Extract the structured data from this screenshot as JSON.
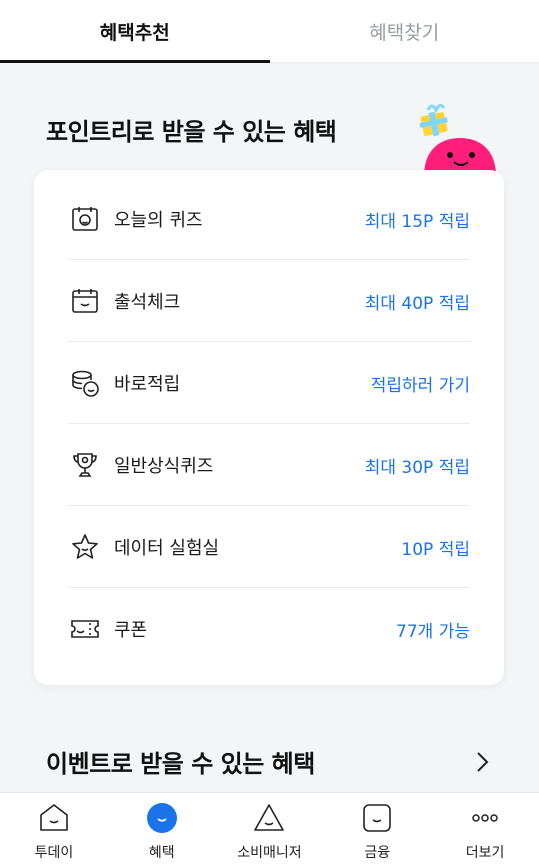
{
  "tabs": [
    {
      "label": "혜택추천",
      "active": true
    },
    {
      "label": "혜택찾기",
      "active": false
    }
  ],
  "section1": {
    "title": "포인트리로 받을 수 있는 혜택"
  },
  "benefits": [
    {
      "icon": "quiz-icon",
      "label": "오늘의 퀴즈",
      "value": "최대 15P 적립"
    },
    {
      "icon": "calendar-icon",
      "label": "출석체크",
      "value": "최대 40P 적립"
    },
    {
      "icon": "coins-icon",
      "label": "바로적립",
      "value": "적립하러 가기"
    },
    {
      "icon": "trophy-icon",
      "label": "일반상식퀴즈",
      "value": "최대 30P 적립"
    },
    {
      "icon": "star-icon",
      "label": "데이터 실험실",
      "value": "10P 적립"
    },
    {
      "icon": "coupon-icon",
      "label": "쿠폰",
      "value": "77개 가능"
    }
  ],
  "section2": {
    "title": "이벤트로 받을 수 있는 혜택"
  },
  "bottom_nav": [
    {
      "icon": "home-smile-icon",
      "label": "투데이"
    },
    {
      "icon": "benefit-smile-icon",
      "label": "혜택",
      "active": true
    },
    {
      "icon": "triangle-smile-icon",
      "label": "소비매니저"
    },
    {
      "icon": "square-smile-icon",
      "label": "금융"
    },
    {
      "icon": "more-dots-icon",
      "label": "더보기"
    }
  ],
  "colors": {
    "accent": "#1a73e8",
    "mascot": "#ff1f7a",
    "active_tab_underline": "#111111"
  }
}
